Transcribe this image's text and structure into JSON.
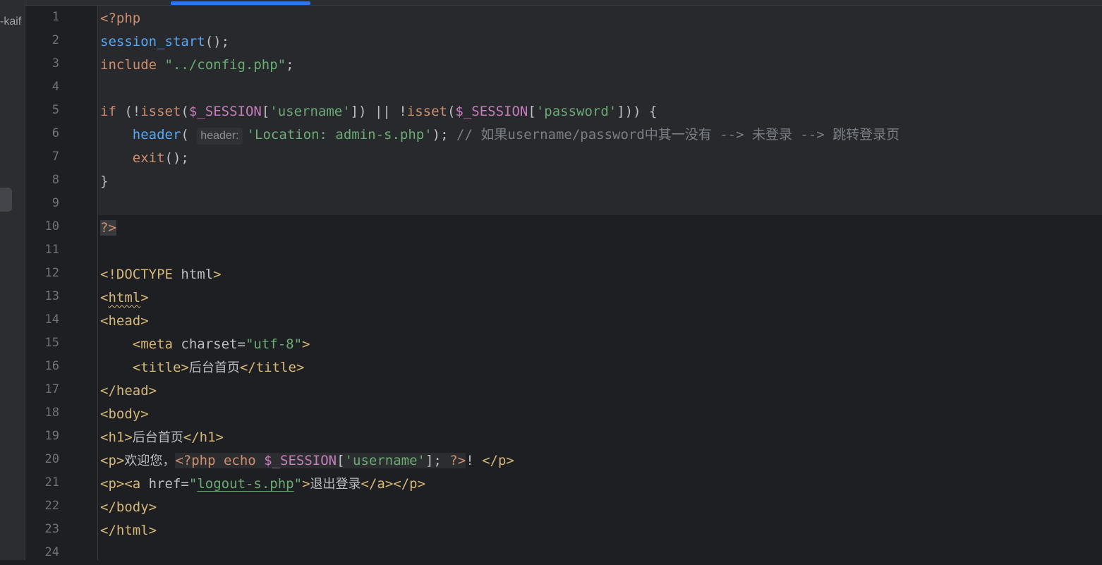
{
  "sidebar": {
    "project_label": "-kaif"
  },
  "lines": [
    {
      "n": "1"
    },
    {
      "n": "2"
    },
    {
      "n": "3"
    },
    {
      "n": "4"
    },
    {
      "n": "5"
    },
    {
      "n": "6"
    },
    {
      "n": "7"
    },
    {
      "n": "8"
    },
    {
      "n": "9"
    },
    {
      "n": "10"
    },
    {
      "n": "11"
    },
    {
      "n": "12"
    },
    {
      "n": "13"
    },
    {
      "n": "14"
    },
    {
      "n": "15"
    },
    {
      "n": "16"
    },
    {
      "n": "17"
    },
    {
      "n": "18"
    },
    {
      "n": "19"
    },
    {
      "n": "20"
    },
    {
      "n": "21"
    },
    {
      "n": "22"
    },
    {
      "n": "23"
    },
    {
      "n": "24"
    }
  ],
  "code": {
    "l1": [
      "<?php"
    ],
    "l2": [
      "session_start",
      "();"
    ],
    "l3": [
      "include",
      " ",
      "\"../config.php\"",
      ";"
    ],
    "l5": [
      "if",
      " (!",
      "isset",
      "(",
      "$_SESSION",
      "[",
      "'username'",
      "]) || !",
      "isset",
      "(",
      "$_SESSION",
      "[",
      "'password'",
      "])) {"
    ],
    "l6": [
      "    ",
      "header",
      "( ",
      "header:",
      "'Location: admin-s.php'",
      "); ",
      "// 如果username/password中其一没有 --> 未登录 --> 跳转登录页"
    ],
    "l7": [
      "    ",
      "exit",
      "();"
    ],
    "l8": [
      "}"
    ],
    "l10": [
      "?>"
    ],
    "l12": [
      "<!DOCTYPE",
      " html",
      ">"
    ],
    "l13": [
      "<",
      "html",
      ">"
    ],
    "l14": [
      "<head>"
    ],
    "l15": [
      "    ",
      "<meta",
      " charset",
      "=",
      "\"utf-8\"",
      ">"
    ],
    "l16": [
      "    ",
      "<title>",
      "后台首页",
      "</title>"
    ],
    "l17": [
      "</head>"
    ],
    "l18": [
      "<body>"
    ],
    "l19": [
      "<h1>",
      "后台首页",
      "</h1>"
    ],
    "l20": [
      "<p>",
      "欢迎您，",
      "<?php",
      " echo ",
      "$_SESSION",
      "[",
      "'username'",
      "]; ",
      "?>",
      "! ",
      "</p>"
    ],
    "l21": [
      "<p>",
      "<a",
      " href",
      "=",
      "\"",
      "logout-s.php",
      "\"",
      ">",
      "退出登录",
      "</a></p>"
    ],
    "l22": [
      "</body>"
    ],
    "l23": [
      "</html>"
    ]
  },
  "colors": {
    "background": "#1e1f22",
    "keyword": "#cf8e6d",
    "function": "#56a8f5",
    "string": "#6aab73",
    "variable": "#c77dbb",
    "comment": "#7a7e85",
    "tag": "#d5b778",
    "accent": "#3574f0"
  }
}
